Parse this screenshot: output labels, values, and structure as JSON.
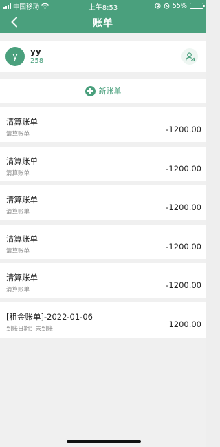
{
  "status_bar": {
    "carrier": "中国移动",
    "time": "上午8:53",
    "battery": "55%",
    "battery_level": 0.55
  },
  "navbar": {
    "title": "账单",
    "back_icon": "chevron-left-icon"
  },
  "user": {
    "avatar_letter": "y",
    "name": "yy",
    "id": "258",
    "action_icon": "user-edit-icon"
  },
  "new_bill": {
    "label": "新账单",
    "icon": "plus-circle-icon"
  },
  "bills": [
    {
      "title": "清算账单",
      "subtitle": "清算账单",
      "amount": "-1200.00"
    },
    {
      "title": "清算账单",
      "subtitle": "清算账单",
      "amount": "-1200.00"
    },
    {
      "title": "清算账单",
      "subtitle": "清算账单",
      "amount": "-1200.00"
    },
    {
      "title": "清算账单",
      "subtitle": "清算账单",
      "amount": "-1200.00"
    },
    {
      "title": "清算账单",
      "subtitle": "清算账单",
      "amount": "-1200.00"
    },
    {
      "title": "[租金账单]-2022-01-06",
      "subtitle": "到账日期：未到账",
      "amount": "1200.00"
    }
  ],
  "colors": {
    "accent": "#4aa07d",
    "background": "#f0f0f0"
  }
}
